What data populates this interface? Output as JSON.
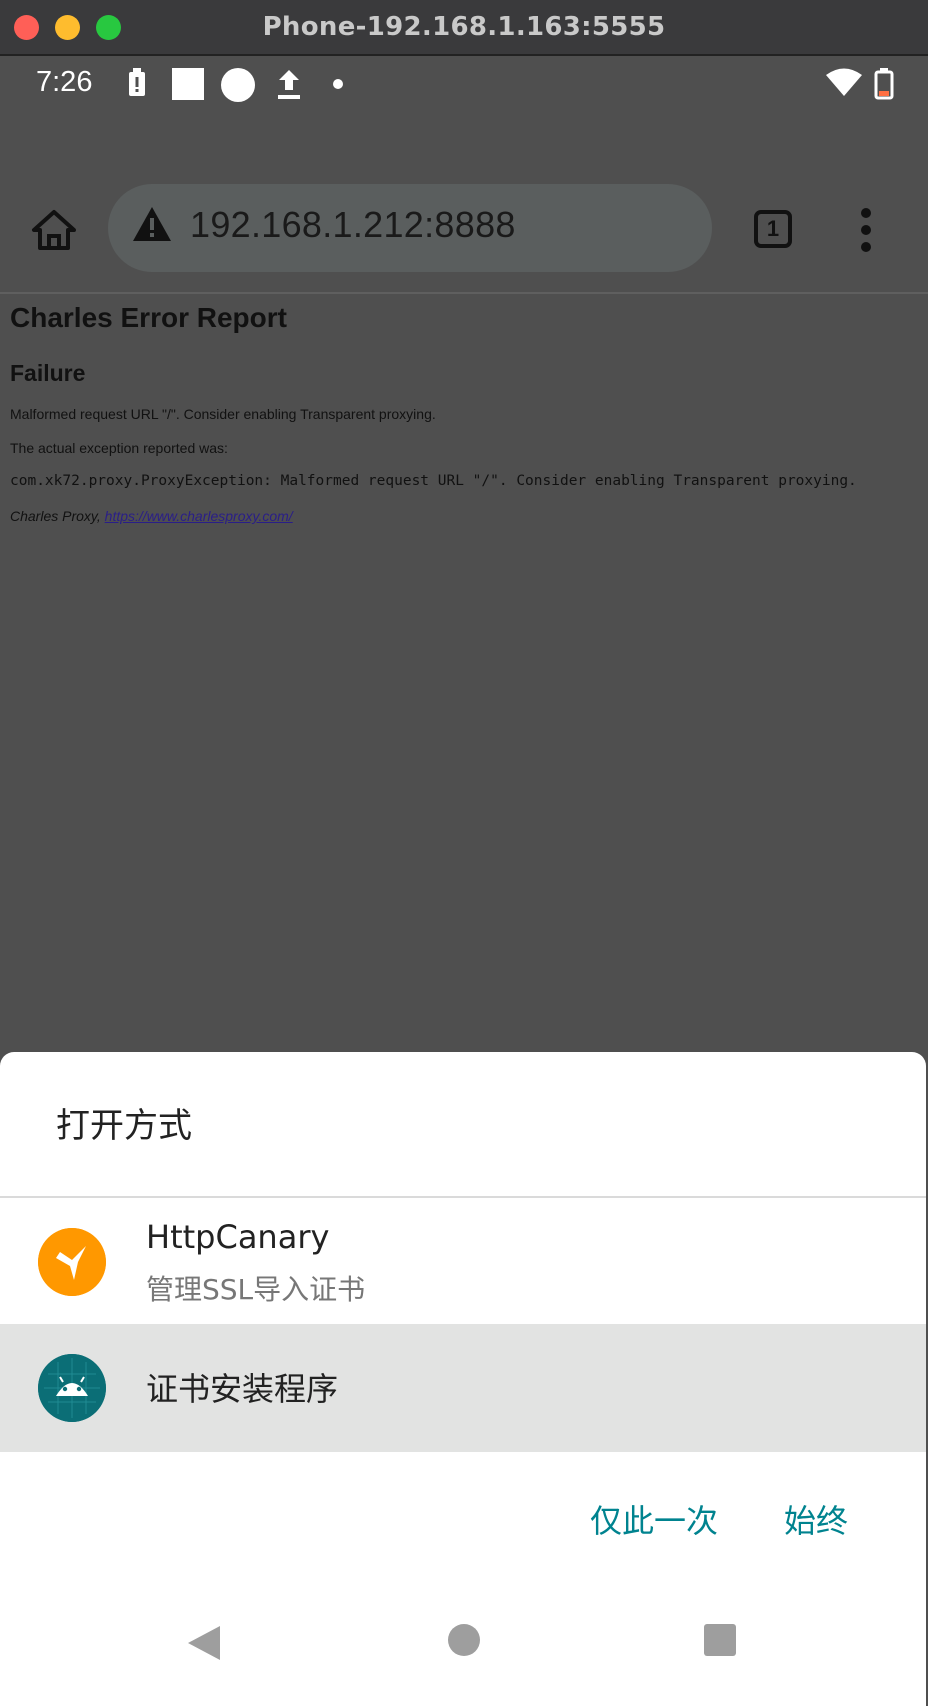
{
  "window": {
    "title": "Phone-192.168.1.163:5555"
  },
  "status_bar": {
    "time": "7:26",
    "icons": [
      "battery-alert-icon",
      "square-icon",
      "circle-icon",
      "upload-icon",
      "dot-icon",
      "wifi-icon",
      "battery-icon"
    ]
  },
  "browser": {
    "url": "192.168.1.212:8888",
    "tab_count": "1",
    "icons": [
      "home-icon",
      "warning-icon",
      "tabs-icon",
      "more-vert-icon"
    ]
  },
  "page": {
    "heading": "Charles Error Report",
    "subheading": "Failure",
    "message": "Malformed request URL \"/\". Consider enabling Transparent proxying.",
    "exception_intro": "The actual exception reported was:",
    "exception": "com.xk72.proxy.ProxyException: Malformed request URL \"/\". Consider enabling Transparent proxying.",
    "footer_prefix": "Charles Proxy, ",
    "footer_link": "https://www.charlesproxy.com/"
  },
  "chooser": {
    "title": "打开方式",
    "apps": [
      {
        "name": "HttpCanary",
        "subtitle": "管理SSL导入证书",
        "icon": "httpcanary-bird-icon"
      },
      {
        "name": "证书安装程序",
        "subtitle": "",
        "icon": "android-icon",
        "selected": true
      }
    ],
    "just_once_label": "仅此一次",
    "always_label": "始终"
  },
  "nav_bar": {
    "icons": [
      "back-icon",
      "home-circle-icon",
      "recents-icon"
    ]
  },
  "colors": {
    "accent": "#00838f",
    "scrim": "#4f4f4f",
    "selected_row": "#e2e3e2",
    "httpcanary_icon_bg": "#ff9800",
    "android_icon_bg": "#0b6e76"
  }
}
